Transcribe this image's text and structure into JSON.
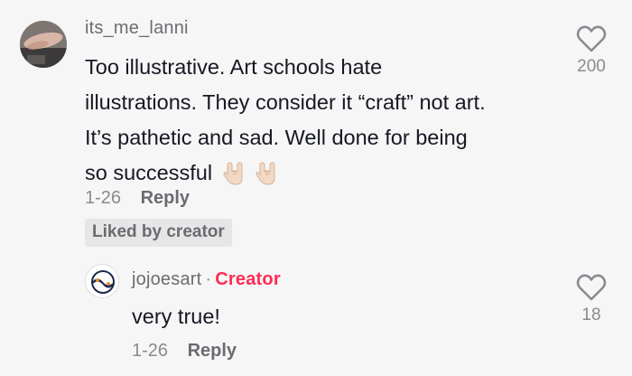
{
  "comment": {
    "username": "its_me_lanni",
    "lines": [
      "Too illustrative. Art schools hate",
      "illustrations. They consider it “craft” not art.",
      "It’s pathetic and sad. Well done for being",
      "so successful"
    ],
    "emoji_icons": [
      "rock-on-hand-icon",
      "rock-on-hand-icon"
    ],
    "date": "1-26",
    "reply_label": "Reply",
    "badge": "Liked by creator",
    "like_count": "200"
  },
  "reply": {
    "username": "jojoesart",
    "separator": "·",
    "creator_label": "Creator",
    "text": "very true!",
    "date": "1-26",
    "reply_label": "Reply",
    "like_count": "18"
  },
  "colors": {
    "background": "#f6f6f6",
    "creator": "#fe2c55",
    "meta": "#8a8b91"
  }
}
